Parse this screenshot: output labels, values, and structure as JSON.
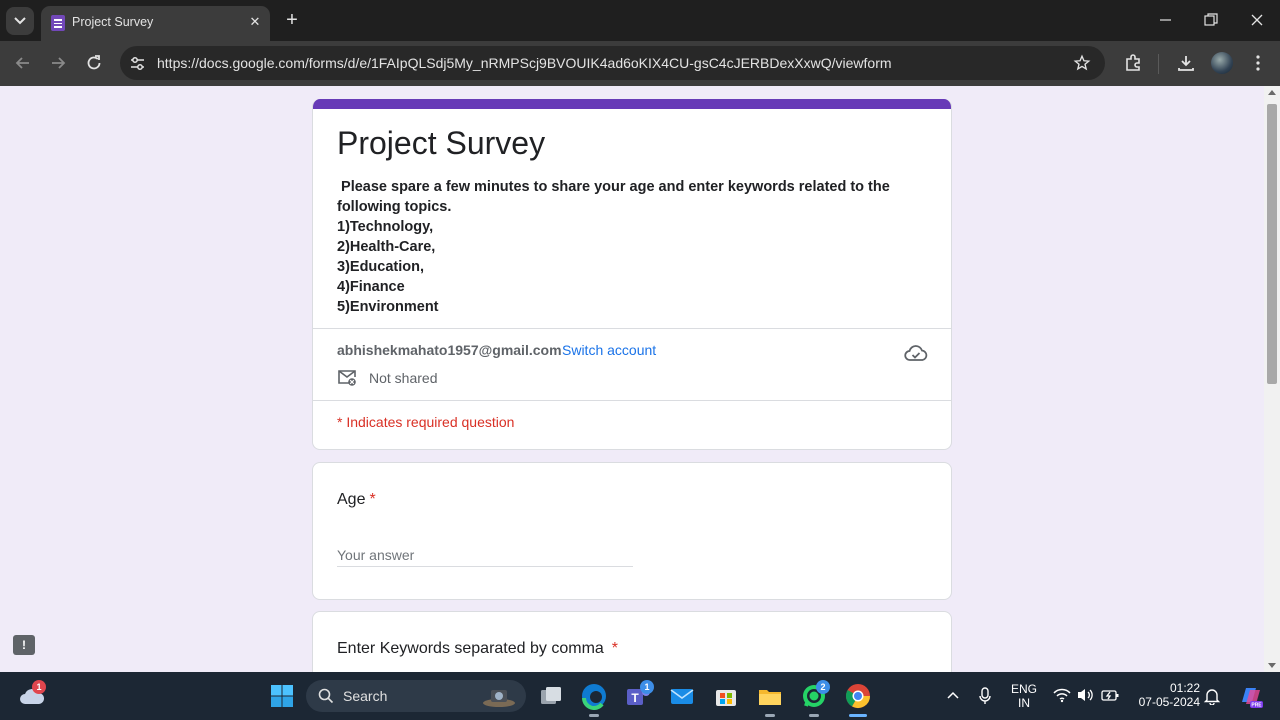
{
  "browser": {
    "tab_title": "Project Survey",
    "url": "https://docs.google.com/forms/d/e/1FAIpQLSdj5My_nRMPScj9BVOUIK4ad6oKIX4CU-gsC4cJERBDexXxwQ/viewform"
  },
  "form": {
    "title": "Project Survey",
    "description_lines": [
      " Please spare a few minutes to share your age and enter keywords related to the",
      "following topics.",
      "1)Technology,",
      "2)Health-Care,",
      "3)Education,",
      "4)Finance",
      "5)Environment"
    ],
    "account_email": "abhishekmahato1957@gmail.com",
    "switch_account": "Switch account",
    "not_shared": "Not shared",
    "required_note": "* Indicates required question",
    "questions": [
      {
        "title": "Age",
        "required_mark": "*",
        "placeholder": "Your answer"
      },
      {
        "title": "Enter Keywords separated by comma",
        "required_mark": "*"
      }
    ]
  },
  "report_button": "!",
  "taskbar": {
    "search_label": "Search",
    "weather_badge": "1",
    "teams_badge": "1",
    "whatsapp_badge": "2",
    "lang_line1": "ENG",
    "lang_line2": "IN",
    "time": "01:22",
    "date": "07-05-2024"
  },
  "colors": {
    "form_accent": "#673ab7",
    "required_red": "#d93025",
    "link_blue": "#1a73e8",
    "page_background": "#f0ebf8"
  }
}
